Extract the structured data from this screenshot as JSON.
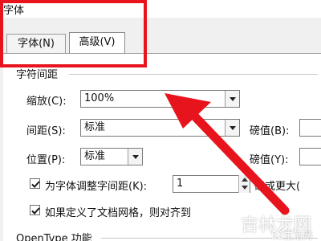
{
  "dialog": {
    "title": "字体"
  },
  "tabs": [
    {
      "label": "字体(N)"
    },
    {
      "label": "高级(V)"
    }
  ],
  "char_spacing": {
    "group_title": "字符间距",
    "scale": {
      "label": "缩放(C):",
      "value": "100%"
    },
    "spacing": {
      "label": "间距(S):",
      "value": "标准",
      "by_label": "磅值(B):"
    },
    "position": {
      "label": "位置(P):",
      "value": "标准",
      "by_label": "磅值(Y):"
    },
    "kerning": {
      "label": "为字体调整字间距(K):",
      "checked": true,
      "value": "1",
      "suffix": "磅或更大("
    },
    "grid": {
      "label": "如果定义了文档网格，则对齐到",
      "checked": true
    }
  },
  "opentype": {
    "group_title": "OpenType 功能"
  },
  "watermark": {
    "main": "吉林龙网",
    "sub": "52生活网"
  },
  "colors": {
    "annotation_red": "#e8141d"
  }
}
